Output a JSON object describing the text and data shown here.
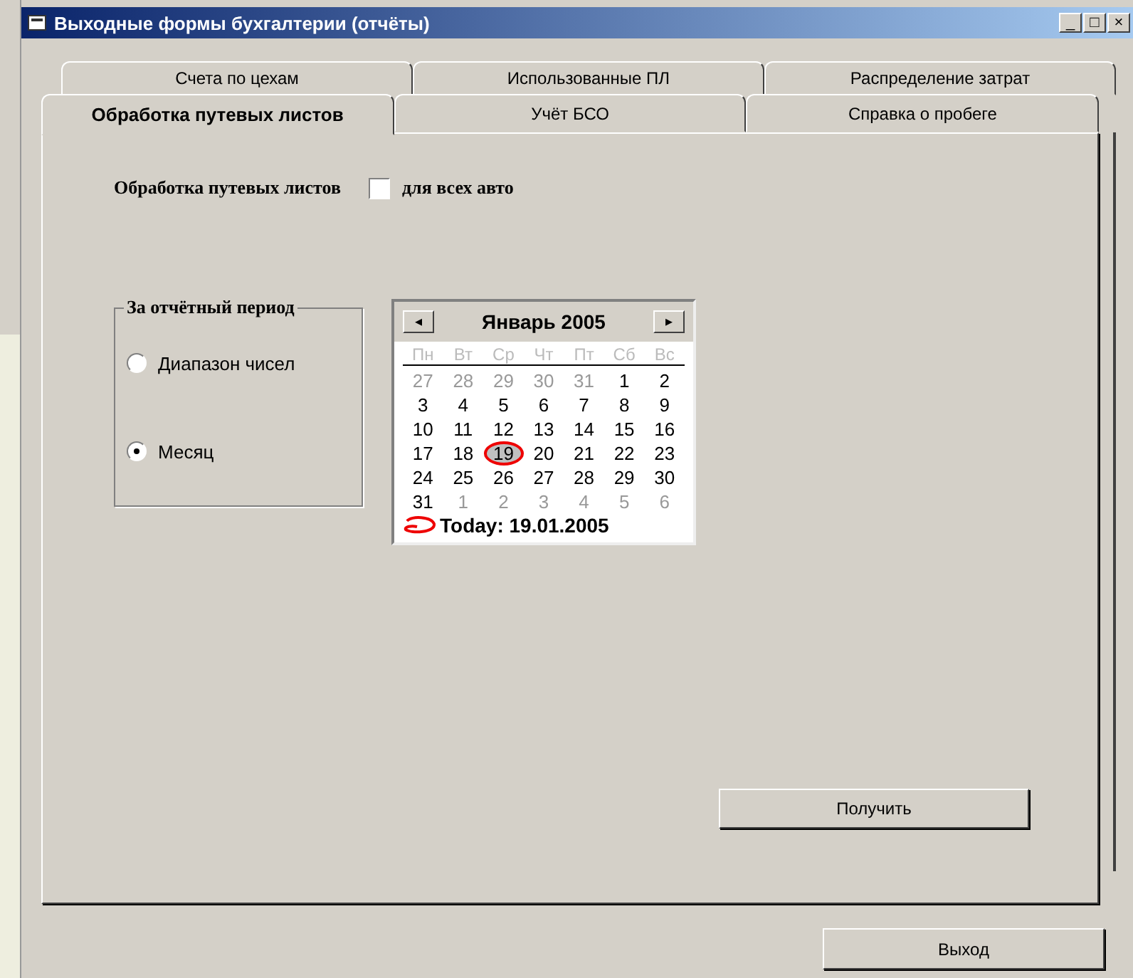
{
  "window": {
    "title": "Выходные формы бухгалтерии (отчёты)"
  },
  "title_buttons": [
    "_",
    "□",
    "×"
  ],
  "tab_rows": [
    [
      {
        "label": "Счета по цехам",
        "selected": false
      },
      {
        "label": "Использованные ПЛ",
        "selected": false
      },
      {
        "label": "Распределение затрат",
        "selected": false
      }
    ],
    [
      {
        "label": "Обработка путевых листов",
        "selected": true
      },
      {
        "label": "Учёт БСО",
        "selected": false
      },
      {
        "label": "Справка о пробеге",
        "selected": false
      }
    ]
  ],
  "heading": "Обработка путевых листов",
  "all_cars": {
    "label": "для всех авто",
    "checked": false
  },
  "period_group": {
    "title": "За отчётный период",
    "options": [
      {
        "label": "Диапазон чисел",
        "selected": false
      },
      {
        "label": "Месяц",
        "selected": true
      }
    ]
  },
  "calendar": {
    "prev": "◂",
    "next": "▸",
    "month": "Январь 2005",
    "weekdays": [
      "Пн",
      "Вт",
      "Ср",
      "Чт",
      "Пт",
      "Сб",
      "Вс"
    ],
    "weeks": [
      [
        {
          "day": "27",
          "other_month": true,
          "selected": false
        },
        {
          "day": "28",
          "other_month": true,
          "selected": false
        },
        {
          "day": "29",
          "other_month": true,
          "selected": false
        },
        {
          "day": "30",
          "other_month": true,
          "selected": false
        },
        {
          "day": "31",
          "other_month": true,
          "selected": false
        },
        {
          "day": "1",
          "other_month": false,
          "selected": false
        },
        {
          "day": "2",
          "other_month": false,
          "selected": false
        }
      ],
      [
        {
          "day": "3",
          "other_month": false,
          "selected": false
        },
        {
          "day": "4",
          "other_month": false,
          "selected": false
        },
        {
          "day": "5",
          "other_month": false,
          "selected": false
        },
        {
          "day": "6",
          "other_month": false,
          "selected": false
        },
        {
          "day": "7",
          "other_month": false,
          "selected": false
        },
        {
          "day": "8",
          "other_month": false,
          "selected": false
        },
        {
          "day": "9",
          "other_month": false,
          "selected": false
        }
      ],
      [
        {
          "day": "10",
          "other_month": false,
          "selected": false
        },
        {
          "day": "11",
          "other_month": false,
          "selected": false
        },
        {
          "day": "12",
          "other_month": false,
          "selected": false
        },
        {
          "day": "13",
          "other_month": false,
          "selected": false
        },
        {
          "day": "14",
          "other_month": false,
          "selected": false
        },
        {
          "day": "15",
          "other_month": false,
          "selected": false
        },
        {
          "day": "16",
          "other_month": false,
          "selected": false
        }
      ],
      [
        {
          "day": "17",
          "other_month": false,
          "selected": false
        },
        {
          "day": "18",
          "other_month": false,
          "selected": false
        },
        {
          "day": "19",
          "other_month": false,
          "selected": true
        },
        {
          "day": "20",
          "other_month": false,
          "selected": false
        },
        {
          "day": "21",
          "other_month": false,
          "selected": false
        },
        {
          "day": "22",
          "other_month": false,
          "selected": false
        },
        {
          "day": "23",
          "other_month": false,
          "selected": false
        }
      ],
      [
        {
          "day": "24",
          "other_month": false,
          "selected": false
        },
        {
          "day": "25",
          "other_month": false,
          "selected": false
        },
        {
          "day": "26",
          "other_month": false,
          "selected": false
        },
        {
          "day": "27",
          "other_month": false,
          "selected": false
        },
        {
          "day": "28",
          "other_month": false,
          "selected": false
        },
        {
          "day": "29",
          "other_month": false,
          "selected": false
        },
        {
          "day": "30",
          "other_month": false,
          "selected": false
        }
      ],
      [
        {
          "day": "31",
          "other_month": false,
          "selected": false
        },
        {
          "day": "1",
          "other_month": true,
          "selected": false
        },
        {
          "day": "2",
          "other_month": true,
          "selected": false
        },
        {
          "day": "3",
          "other_month": true,
          "selected": false
        },
        {
          "day": "4",
          "other_month": true,
          "selected": false
        },
        {
          "day": "5",
          "other_month": true,
          "selected": false
        },
        {
          "day": "6",
          "other_month": true,
          "selected": false
        }
      ]
    ],
    "today": "Today: 19.01.2005"
  },
  "get_button": "Получить",
  "exit_button": "Выход"
}
